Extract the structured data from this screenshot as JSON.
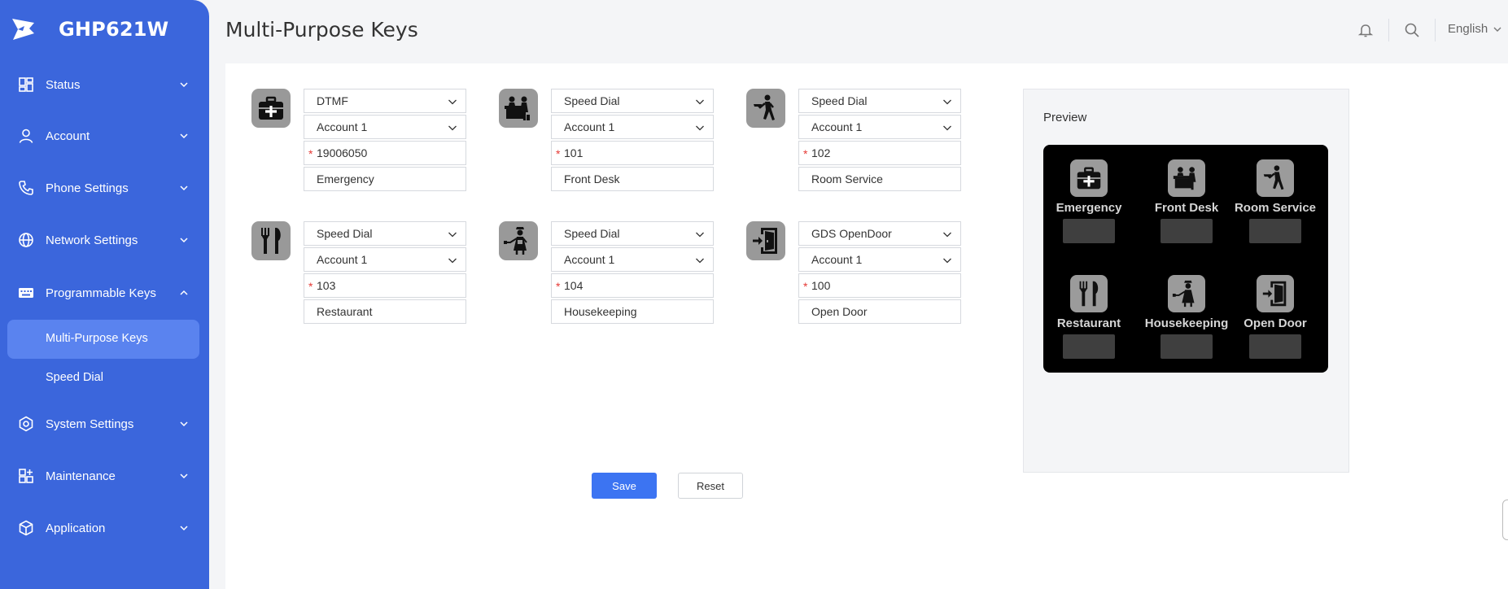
{
  "app": {
    "name": "GHP621W"
  },
  "sidebar": {
    "items": [
      {
        "label": "Status"
      },
      {
        "label": "Account"
      },
      {
        "label": "Phone Settings"
      },
      {
        "label": "Network Settings"
      },
      {
        "label": "Programmable Keys"
      },
      {
        "label": "System Settings"
      },
      {
        "label": "Maintenance"
      },
      {
        "label": "Application"
      }
    ],
    "sub_items": [
      {
        "label": "Multi-Purpose Keys",
        "active": true
      },
      {
        "label": "Speed Dial",
        "active": false
      }
    ]
  },
  "header": {
    "title": "Multi-Purpose Keys",
    "language": "English"
  },
  "keys": [
    {
      "icon": "emergency-icon",
      "mode": "DTMF",
      "account": "Account 1",
      "value": "19006050",
      "label": "Emergency"
    },
    {
      "icon": "front-desk-icon",
      "mode": "Speed Dial",
      "account": "Account 1",
      "value": "101",
      "label": "Front Desk"
    },
    {
      "icon": "room-service-icon",
      "mode": "Speed Dial",
      "account": "Account 1",
      "value": "102",
      "label": "Room Service"
    },
    {
      "icon": "restaurant-icon",
      "mode": "Speed Dial",
      "account": "Account 1",
      "value": "103",
      "label": "Restaurant"
    },
    {
      "icon": "housekeeping-icon",
      "mode": "Speed Dial",
      "account": "Account 1",
      "value": "104",
      "label": "Housekeeping"
    },
    {
      "icon": "open-door-icon",
      "mode": "GDS OpenDoor",
      "account": "Account 1",
      "value": "100",
      "label": "Open Door"
    }
  ],
  "buttons": {
    "save": "Save",
    "reset": "Reset"
  },
  "preview": {
    "title": "Preview"
  },
  "colors": {
    "sidebar": "#3b66dc",
    "sidebar_active": "#5a83ef",
    "primary_button": "#3c74f2",
    "required_marker": "#e53935"
  }
}
